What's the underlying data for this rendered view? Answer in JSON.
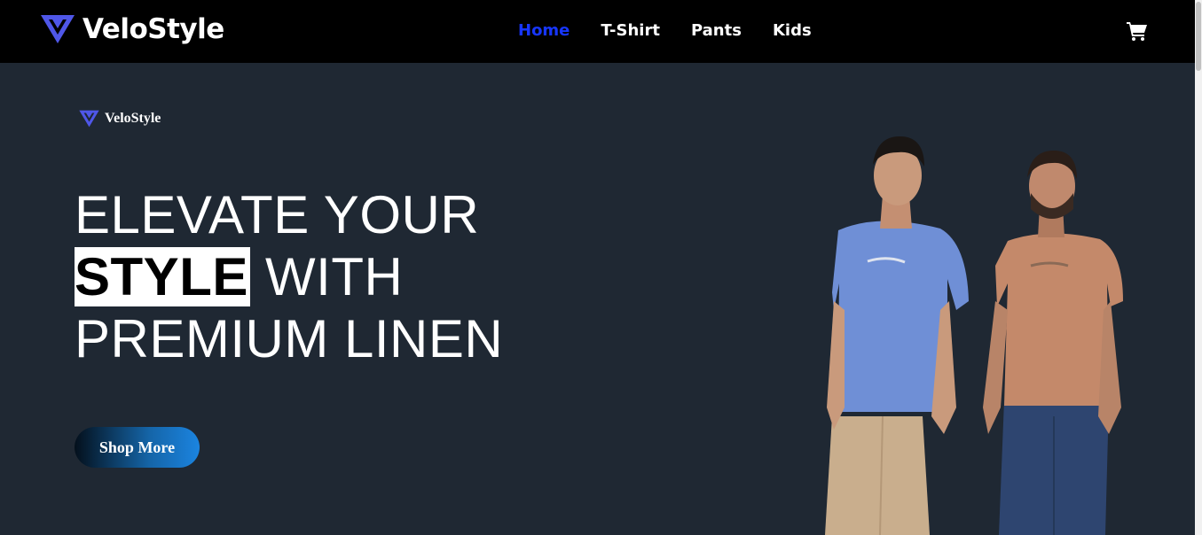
{
  "navbar": {
    "brand": "VeloStyle",
    "links": [
      {
        "label": "Home",
        "active": true
      },
      {
        "label": "T-Shirt",
        "active": false
      },
      {
        "label": "Pants",
        "active": false
      },
      {
        "label": "Kids",
        "active": false
      }
    ],
    "cart_icon": "cart-icon"
  },
  "hero": {
    "brand": "VeloStyle",
    "headline": {
      "line1": "ELEVATE YOUR",
      "highlight": "STYLE",
      "line2_rest": " WITH",
      "line3": "PREMIUM LINEN"
    },
    "cta_label": "Shop More"
  },
  "colors": {
    "background": "#1f2833",
    "navbar": "#000000",
    "nav_active": "#1736ff",
    "logo": "#4f57e8",
    "cta_gradient_start": "#04101c",
    "cta_gradient_end": "#1b84e0"
  }
}
